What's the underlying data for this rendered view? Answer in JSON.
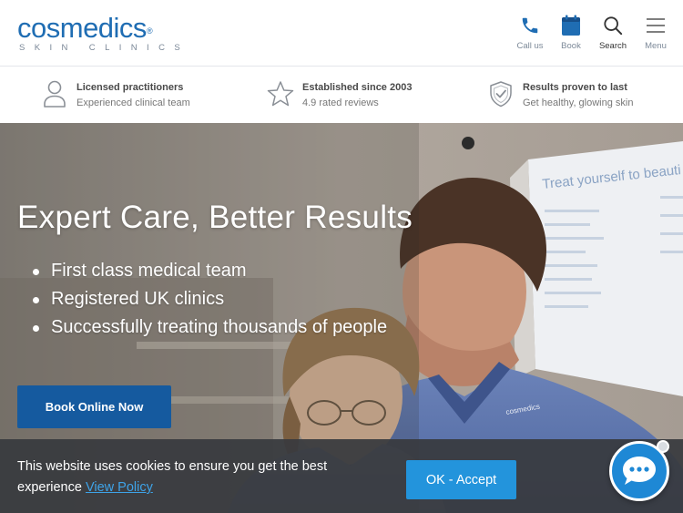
{
  "header": {
    "logo_main": "cosmedics",
    "logo_reg": "®",
    "logo_sub": "SKIN CLINICS",
    "nav": [
      {
        "label": "Call us",
        "icon": "phone-icon"
      },
      {
        "label": "Book",
        "icon": "calendar-icon"
      },
      {
        "label": "Search",
        "icon": "search-icon"
      },
      {
        "label": "Menu",
        "icon": "menu-icon"
      }
    ]
  },
  "trust_bar": {
    "items": [
      {
        "title": "Licensed practitioners",
        "subtitle": "Experienced clinical team",
        "icon": "person-icon"
      },
      {
        "title": "Established since 2003",
        "subtitle": "4.9 rated reviews",
        "icon": "star-icon"
      },
      {
        "title": "Results proven to last",
        "subtitle": "Get healthy, glowing skin",
        "icon": "shield-check-icon"
      }
    ]
  },
  "hero": {
    "title": "Expert Care, Better Results",
    "bullets": [
      "First class medical team",
      "Registered UK clinics",
      "Successfully treating thousands of people"
    ],
    "button_label": "Book Online Now",
    "poster_text": "Treat yourself to beauti",
    "scrub_logo": "cosmedics"
  },
  "cookie_banner": {
    "text": "This website uses cookies to ensure you get the best experience",
    "link_label": "View Policy",
    "accept_label": "OK - Accept"
  },
  "colors": {
    "brand_blue": "#1f6db3",
    "button_blue": "#155a9f",
    "accept_blue": "#2394dc",
    "chat_blue": "#1e88d5",
    "link_blue": "#3ea3e8"
  }
}
